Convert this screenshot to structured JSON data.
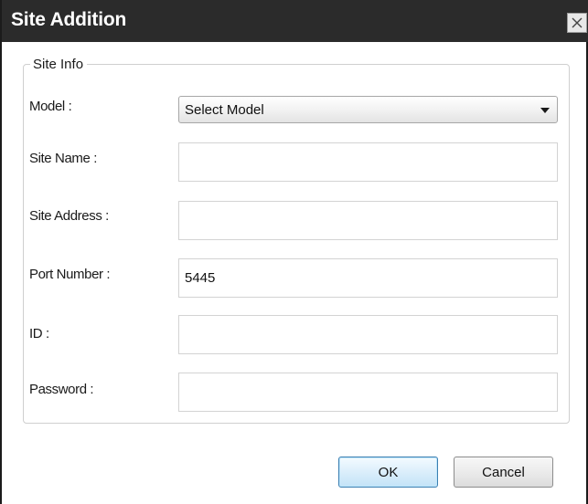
{
  "dialog": {
    "title": "Site Addition"
  },
  "site_info": {
    "legend": "Site Info",
    "model_label": "Model :",
    "model_selected": "Select Model",
    "site_name_label": "Site Name :",
    "site_name_value": "",
    "site_address_label": "Site Address :",
    "site_address_value": "",
    "port_number_label": "Port Number :",
    "port_number_value": "5445",
    "id_label": "ID :",
    "id_value": "",
    "password_label": "Password :",
    "password_value": ""
  },
  "buttons": {
    "ok_label": "OK",
    "cancel_label": "Cancel"
  },
  "icons": {
    "close": "close-icon",
    "dropdown": "chevron-down-icon"
  },
  "colors": {
    "titlebar": "#2b2b2b",
    "title_text": "#ffffff",
    "ok_border": "#3c7fb1",
    "ok_fill": "#dbeefb"
  }
}
